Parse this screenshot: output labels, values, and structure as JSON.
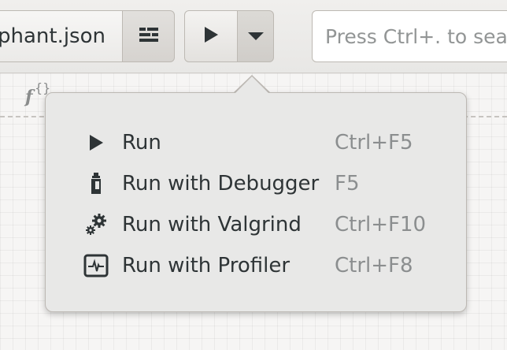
{
  "header": {
    "file_name": "phant.json",
    "pane_icon": "split-pane-icon",
    "run_icon": "play-icon",
    "run_menu_icon": "chevron-down-icon",
    "search": {
      "placeholder": "Press Ctrl+. to sea"
    }
  },
  "editor": {
    "function_icon": "function-icon",
    "function_name": "",
    "grid": true
  },
  "run_menu": {
    "items": [
      {
        "label": "Run",
        "accel": "Ctrl+F5",
        "icon": "play-icon"
      },
      {
        "label": "Run with Debugger",
        "accel": "F5",
        "icon": "debugger-icon"
      },
      {
        "label": "Run with Valgrind",
        "accel": "Ctrl+F10",
        "icon": "gears-icon"
      },
      {
        "label": "Run with Profiler",
        "accel": "Ctrl+F8",
        "icon": "profiler-icon"
      }
    ]
  },
  "colors": {
    "text": "#2e3436",
    "accel_text": "#8b8e8f",
    "popover_bg": "#e8e8e7"
  }
}
